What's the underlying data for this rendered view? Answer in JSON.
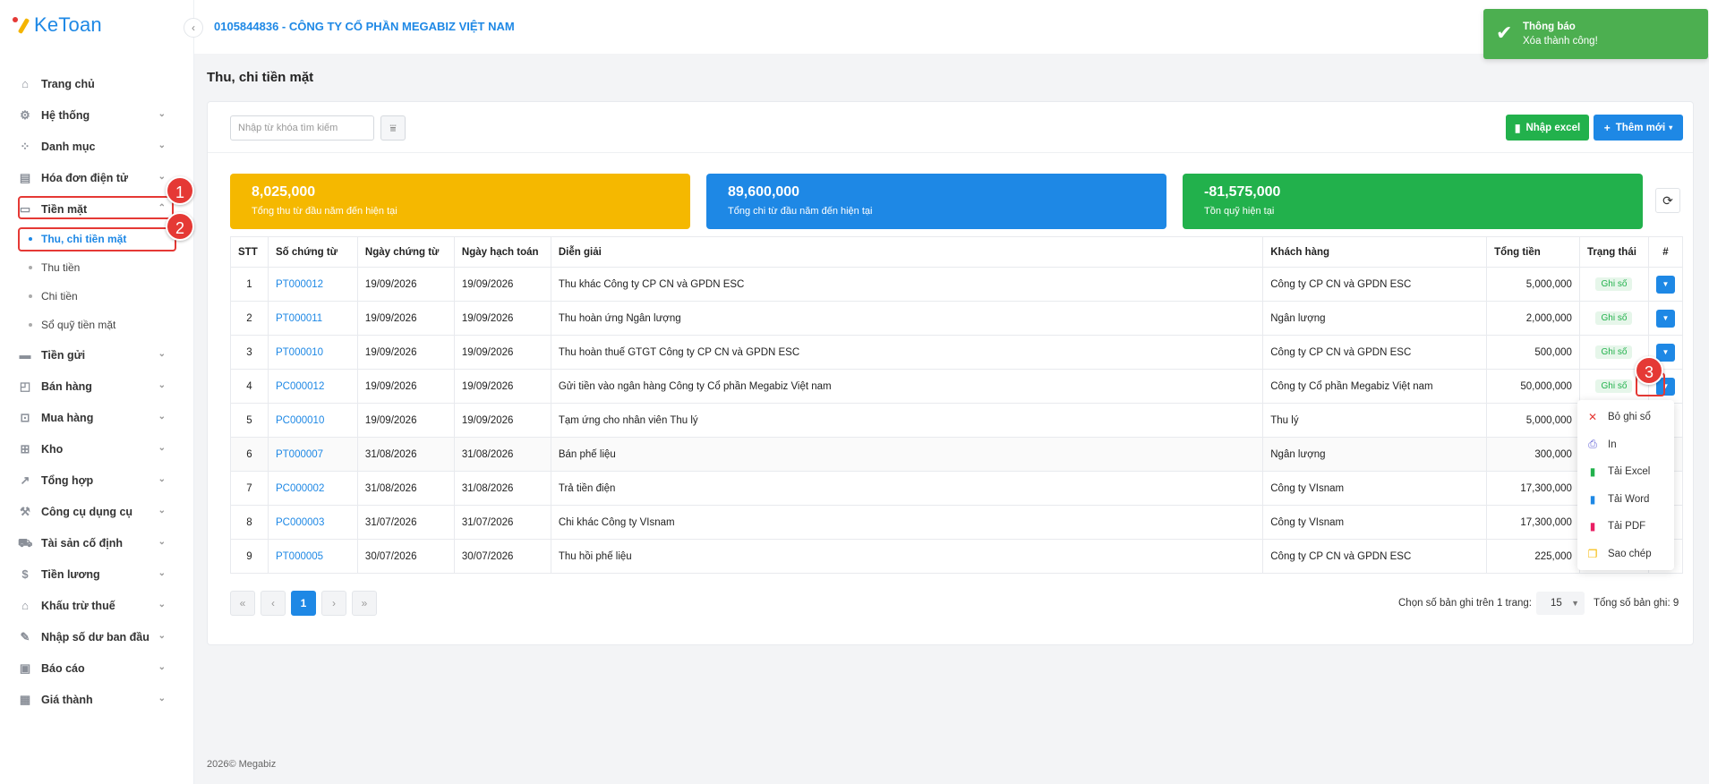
{
  "app": {
    "name": "KeToan",
    "company": "0105844836 - CÔNG TY CỔ PHẦN MEGABIZ VIỆT NAM"
  },
  "toast": {
    "title": "Thông báo",
    "message": "Xóa thành công!"
  },
  "sidebar": {
    "items": [
      {
        "label": "Trang chủ",
        "icon": "home-icon"
      },
      {
        "label": "Hệ thống",
        "icon": "gear-icon"
      },
      {
        "label": "Danh mục",
        "icon": "grid-icon"
      },
      {
        "label": "Hóa đơn điện tử",
        "icon": "invoice-icon"
      },
      {
        "label": "Tiền mặt",
        "icon": "cash-icon"
      },
      {
        "label": "Tiền gửi",
        "icon": "bank-card-icon"
      },
      {
        "label": "Bán hàng",
        "icon": "shopping-bag-icon"
      },
      {
        "label": "Mua hàng",
        "icon": "cart-icon"
      },
      {
        "label": "Kho",
        "icon": "warehouse-icon"
      },
      {
        "label": "Tổng hợp",
        "icon": "chart-line-icon"
      },
      {
        "label": "Công cụ dụng cụ",
        "icon": "tools-icon"
      },
      {
        "label": "Tài sản cố định",
        "icon": "car-icon"
      },
      {
        "label": "Tiền lương",
        "icon": "dollar-icon"
      },
      {
        "label": "Khấu trừ thuế",
        "icon": "bank-icon"
      },
      {
        "label": "Nhập số dư ban đầu",
        "icon": "edit-icon"
      },
      {
        "label": "Báo cáo",
        "icon": "report-icon"
      },
      {
        "label": "Giá thành",
        "icon": "calculator-icon"
      }
    ],
    "cash_sub": [
      {
        "label": "Thu, chi tiền mặt"
      },
      {
        "label": "Thu tiền"
      },
      {
        "label": "Chi tiền"
      },
      {
        "label": "Sổ quỹ tiền mặt"
      }
    ]
  },
  "annotations": {
    "one": "1",
    "two": "2",
    "three": "3"
  },
  "page": {
    "title": "Thu, chi tiền mặt"
  },
  "toolbar": {
    "search_placeholder": "Nhập từ khóa tìm kiếm",
    "excel_label": "Nhập excel",
    "new_label": "Thêm mới"
  },
  "stats": [
    {
      "value": "8,025,000",
      "label": "Tổng thu từ đầu năm đến hiện tại",
      "color": "#f5b800"
    },
    {
      "value": "89,600,000",
      "label": "Tổng chi từ đầu năm đến hiện tại",
      "color": "#1e88e5"
    },
    {
      "value": "-81,575,000",
      "label": "Tồn quỹ hiện tại",
      "color": "#22b14c"
    }
  ],
  "table": {
    "headers": [
      "STT",
      "Số chứng từ",
      "Ngày chứng từ",
      "Ngày hạch toán",
      "Diễn giải",
      "Khách hàng",
      "Tổng tiền",
      "Trạng thái",
      "#"
    ],
    "rows": [
      {
        "stt": "1",
        "doc": "PT000012",
        "date": "19/09/2026",
        "post": "19/09/2026",
        "desc": "Thu khác Công ty CP CN và GPDN ESC",
        "customer": "Công ty CP CN và GPDN ESC",
        "total": "5,000,000",
        "status": "Ghi số"
      },
      {
        "stt": "2",
        "doc": "PT000011",
        "date": "19/09/2026",
        "post": "19/09/2026",
        "desc": "Thu hoàn ứng Ngân lượng",
        "customer": "Ngân lượng",
        "total": "2,000,000",
        "status": "Ghi số"
      },
      {
        "stt": "3",
        "doc": "PT000010",
        "date": "19/09/2026",
        "post": "19/09/2026",
        "desc": "Thu hoàn thuế GTGT Công ty CP CN và GPDN ESC",
        "customer": "Công ty CP CN và GPDN ESC",
        "total": "500,000",
        "status": "Ghi số"
      },
      {
        "stt": "4",
        "doc": "PC000012",
        "date": "19/09/2026",
        "post": "19/09/2026",
        "desc": "Gửi tiền vào ngân hàng Công ty Cổ phần Megabiz Việt nam",
        "customer": "Công ty Cổ phần Megabiz Việt nam",
        "total": "50,000,000",
        "status": "Ghi số"
      },
      {
        "stt": "5",
        "doc": "PC000010",
        "date": "19/09/2026",
        "post": "19/09/2026",
        "desc": "Tạm ứng cho nhân viên Thu lý",
        "customer": "Thu lý",
        "total": "5,000,000",
        "status": ""
      },
      {
        "stt": "6",
        "doc": "PT000007",
        "date": "31/08/2026",
        "post": "31/08/2026",
        "desc": "Bán phế liệu",
        "customer": "Ngân lượng",
        "total": "300,000",
        "status": ""
      },
      {
        "stt": "7",
        "doc": "PC000002",
        "date": "31/08/2026",
        "post": "31/08/2026",
        "desc": "Trả tiền điện",
        "customer": "Công ty VIsnam",
        "total": "17,300,000",
        "status": ""
      },
      {
        "stt": "8",
        "doc": "PC000003",
        "date": "31/07/2026",
        "post": "31/07/2026",
        "desc": "Chi khác Công ty VIsnam",
        "customer": "Công ty VIsnam",
        "total": "17,300,000",
        "status": ""
      },
      {
        "stt": "9",
        "doc": "PT000005",
        "date": "30/07/2026",
        "post": "30/07/2026",
        "desc": "Thu hồi phế liệu",
        "customer": "Công ty CP CN và GPDN ESC",
        "total": "225,000",
        "status": ""
      }
    ]
  },
  "dropdown": [
    {
      "label": "Bỏ ghi sổ",
      "icon": "x-icon",
      "color": "#e53935"
    },
    {
      "label": "In",
      "icon": "printer-icon",
      "color": "#5b5bd6"
    },
    {
      "label": "Tải Excel",
      "icon": "excel-icon",
      "color": "#22b14c"
    },
    {
      "label": "Tải Word",
      "icon": "word-icon",
      "color": "#1e88e5"
    },
    {
      "label": "Tải PDF",
      "icon": "pdf-icon",
      "color": "#e91e63"
    },
    {
      "label": "Sao chép",
      "icon": "copy-icon",
      "color": "#f5b800"
    }
  ],
  "pagination": {
    "current": "1",
    "per_page_label": "Chọn số bản ghi trên 1 trang:",
    "per_page": "15",
    "total_label": "Tổng số bản ghi:",
    "total": "9"
  },
  "footer": {
    "text": "2026© Megabiz"
  }
}
